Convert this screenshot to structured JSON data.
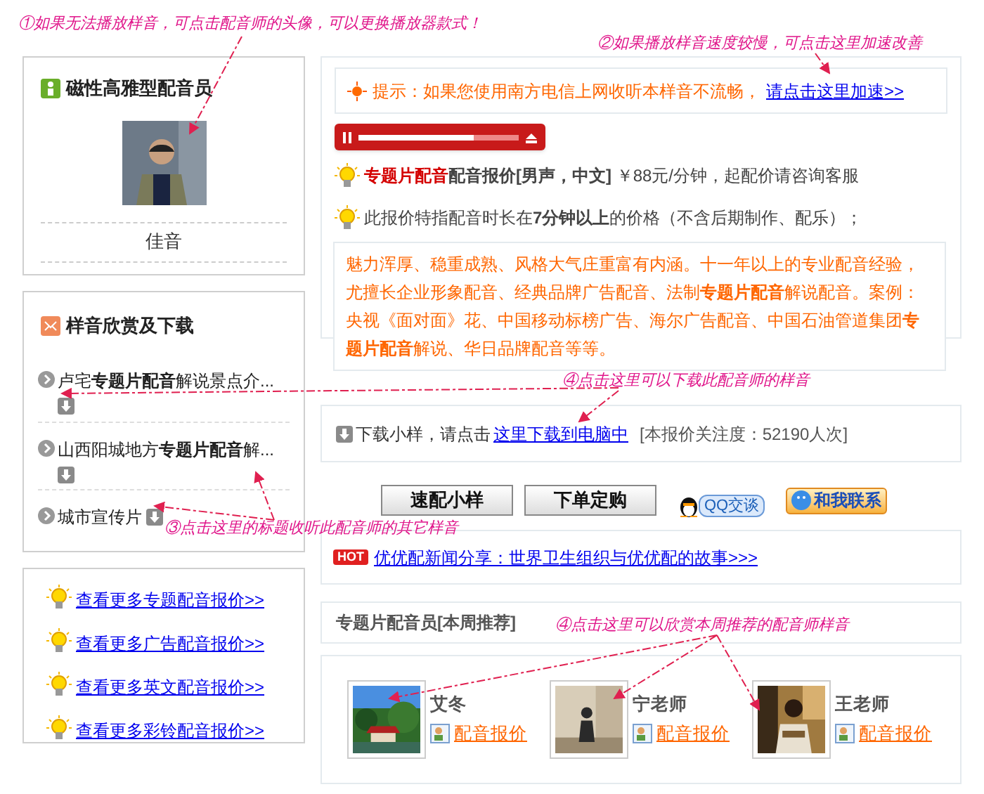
{
  "annotations": [
    {
      "text": "①如果无法播放样音，可点击配音师的头像，可以更换播放器款式！"
    },
    {
      "text": "②如果播放样音速度较慢，可点击这里加速改善"
    },
    {
      "text": "④点击这里可以下载此配音师的样音"
    },
    {
      "text": "③点击这里的标题收听此配音师的其它样音"
    },
    {
      "text": "④点击这里可以欣赏本周推荐的配音师样音"
    }
  ],
  "profile": {
    "title": "磁性高雅型配音员",
    "name": "佳音"
  },
  "samples": {
    "title": "样音欣赏及下载",
    "items": [
      {
        "title": "卢宅**专题片配音**解说景点介...",
        "download": true
      },
      {
        "title": "山西阳城地方**专题片配音**解...",
        "download": true
      },
      {
        "title": "城市宣传片",
        "download": true
      }
    ]
  },
  "more_links": [
    "查看更多专题配音报价>>",
    "查看更多广告配音报价>>",
    "查看更多英文配音报价>>",
    "查看更多彩铃配音报价>>"
  ],
  "hint": {
    "text": "提示：如果您使用南方电信上网收听本样音不流畅，",
    "link": "请点击这里加速>>"
  },
  "player": {
    "playing": true,
    "level": 0.72
  },
  "price": {
    "highlight": "专题片配音",
    "label": "配音报价[男声，中文]",
    "text": "￥88元/分钟，起配价请咨询客服"
  },
  "duration_note": "此报价特指配音时长在**7分钟以上**的价格（不含后期制作、配乐）；",
  "description": "魅力浑厚、稳重成熟、风格大气庄重富有内涵。十一年以上的专业配音经验，尤擅长企业形象配音、经典品牌广告配音、法制**专题片配音**解说配音。案例：央视《面对面》花、中国移动标榜广告、海尔广告配音、中国石油管道集团**专题片配音**解说、华日品牌配音等等。",
  "download": {
    "text": "下载小样，请点击",
    "link": "这里下载到电脑中",
    "views": "[本报价关注度：52190人次]"
  },
  "buttons": [
    "速配小样",
    "下单定购"
  ],
  "contacts": [
    "QQ交谈",
    "和我联系"
  ],
  "news": {
    "badge": "HOT",
    "link": "优优配新闻分享：世界卫生组织与优优配的故事>>>"
  },
  "recommend": {
    "title": "专题片配音员[本周推荐]",
    "items": [
      {
        "name": "艾冬",
        "link": "配音报价"
      },
      {
        "name": "宁老师",
        "link": "配音报价"
      },
      {
        "name": "王老师",
        "link": "配音报价"
      }
    ]
  }
}
